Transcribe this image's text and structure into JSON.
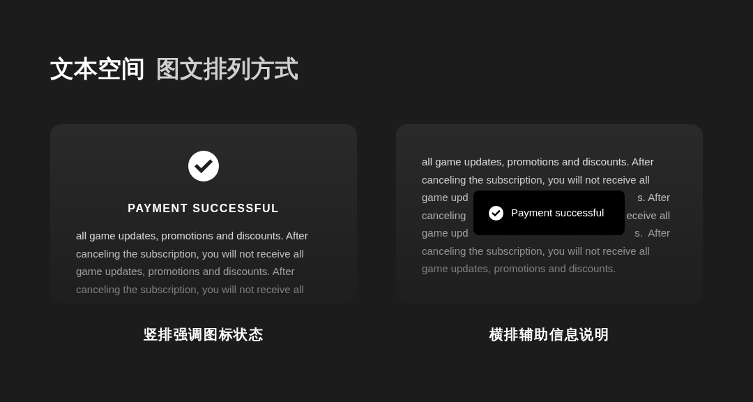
{
  "title": {
    "primary": "文本空间",
    "secondary": "图文排列方式"
  },
  "cards": [
    {
      "kind": "vertical",
      "heading": "PAYMENT SUCCESSFUL",
      "caption": "竖排强调图标状态",
      "lines": [
        {
          "parts": [
            "all game updates, promotions and discounts. After"
          ]
        },
        {
          "parts": [
            "canceling the subscription, you will not receive all"
          ]
        },
        {
          "parts": [
            "game updates, promotions and discounts. After"
          ]
        },
        {
          "parts": [
            "canceling the subscription, you will not receive all"
          ]
        }
      ]
    },
    {
      "kind": "horizontal",
      "toast": "Payment successful",
      "caption": "横排辅助信息说明",
      "lines": [
        {
          "parts": [
            "all game updates, promotions and discounts. After"
          ]
        },
        {
          "parts": [
            "canceling the subscription, you will not receive all"
          ]
        },
        {
          "parts": [
            "game upd",
            "s. After"
          ]
        },
        {
          "parts": [
            "canceling",
            "eceive all"
          ]
        },
        {
          "parts": [
            "game upd",
            "s.  After"
          ]
        },
        {
          "parts": [
            "canceling the subscription, you will not receive all"
          ]
        },
        {
          "parts": [
            "game updates, promotions and discounts."
          ]
        }
      ]
    }
  ]
}
